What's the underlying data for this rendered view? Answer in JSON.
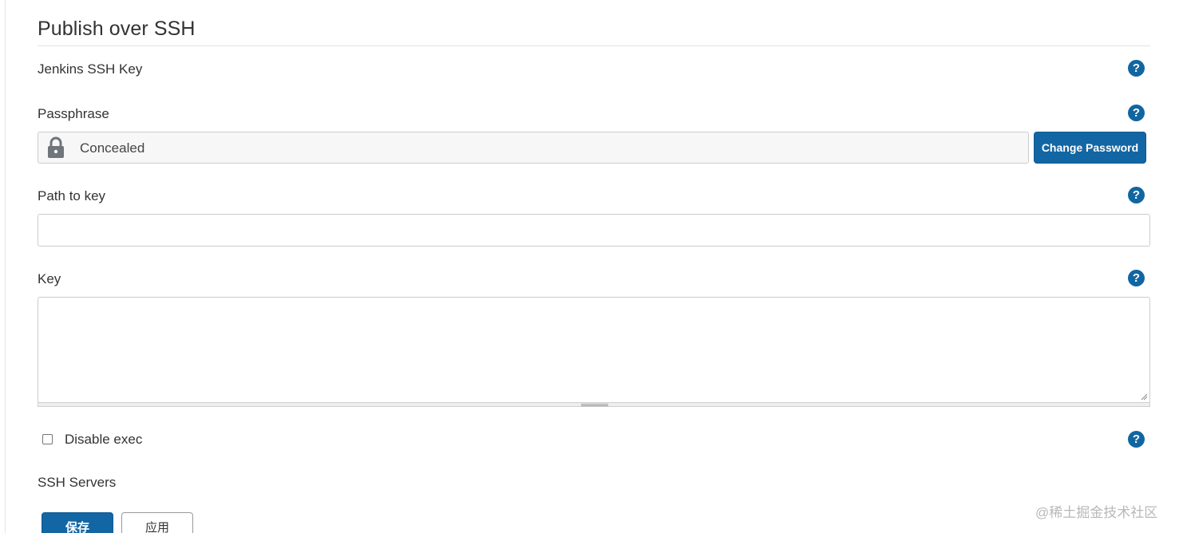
{
  "section": {
    "title": "Publish over SSH"
  },
  "fields": {
    "jenkins_ssh_key": {
      "label": "Jenkins SSH Key"
    },
    "passphrase": {
      "label": "Passphrase",
      "concealed_text": "Concealed",
      "change_button": "Change Password"
    },
    "path_to_key": {
      "label": "Path to key",
      "value": ""
    },
    "key": {
      "label": "Key",
      "value": ""
    },
    "disable_exec": {
      "label": "Disable exec",
      "checked": false
    },
    "ssh_servers": {
      "label": "SSH Servers"
    }
  },
  "help": {
    "glyph": "?"
  },
  "buttons": {
    "save": "保存",
    "apply": "应用"
  },
  "watermark": "@稀土掘金技术社区",
  "colors": {
    "accent": "#1266a3",
    "help_icon": "#1166a1",
    "border": "#cccccc"
  },
  "icons": [
    "help-icon",
    "lock-icon"
  ]
}
